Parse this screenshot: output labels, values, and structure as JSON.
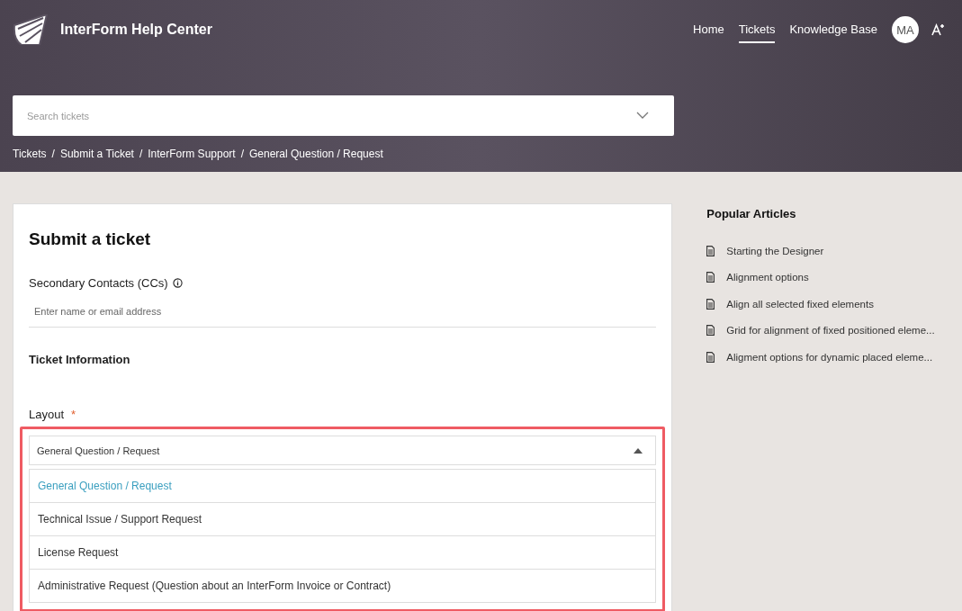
{
  "header": {
    "brand": "InterForm Help Center",
    "nav": [
      {
        "label": "Home",
        "selected": false
      },
      {
        "label": "Tickets",
        "selected": true
      },
      {
        "label": "Knowledge Base",
        "selected": false
      }
    ],
    "avatar": "MA",
    "search": {
      "placeholder": "Search tickets"
    },
    "breadcrumb_separator": "/",
    "breadcrumb": [
      "Tickets",
      "Submit a Ticket",
      "InterForm Support",
      "General Question / Request"
    ]
  },
  "form": {
    "title": "Submit a ticket",
    "cc": {
      "label": "Secondary Contacts (CCs)",
      "placeholder": "Enter name or email address"
    },
    "section": "Ticket Information",
    "layout": {
      "label": "Layout",
      "required": "*",
      "value": "General Question / Request",
      "expanded": true,
      "highlighted": true,
      "options": [
        {
          "label": "General Question / Request",
          "selected": true
        },
        {
          "label": "Technical Issue / Support Request",
          "selected": false
        },
        {
          "label": "License Request",
          "selected": false
        },
        {
          "label": "Administrative Request (Question about an InterForm Invoice or Contract)",
          "selected": false
        }
      ]
    }
  },
  "sidebar": {
    "title": "Popular Articles",
    "articles": [
      "Starting the Designer",
      "Alignment options",
      "Align all selected fixed elements",
      "Grid for alignment of fixed positioned eleme...",
      "Aligment options for dynamic placed eleme..."
    ]
  }
}
